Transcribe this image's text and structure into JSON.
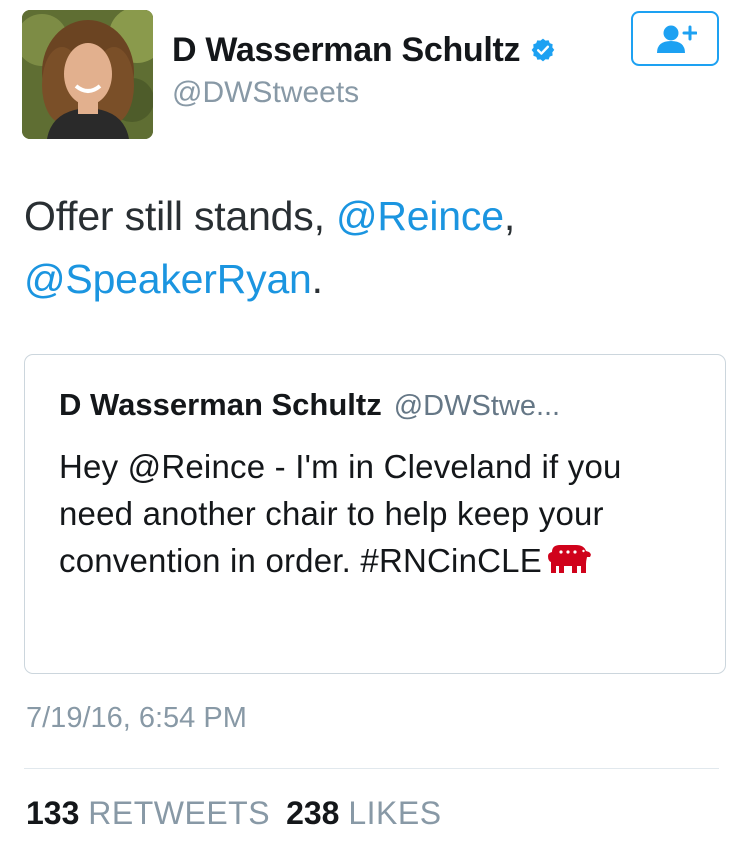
{
  "author": {
    "name": "D Wasserman Schultz",
    "handle": "@DWStweets",
    "verified": true
  },
  "follow_button": {
    "icon": "add-user-icon"
  },
  "tweet": {
    "text_prefix": "Offer still stands, ",
    "mention1": "@Reince",
    "text_mid": ",",
    "mention2": "@SpeakerRyan",
    "text_suffix": "."
  },
  "quoted_tweet": {
    "author_name": "D Wasserman Schultz",
    "author_handle": "@DWStwe...",
    "text": "Hey @Reince - I'm in Cleveland if you need another chair to help keep your convention in order. #RNCinCLE",
    "emoji": "elephant-icon"
  },
  "timestamp": "7/19/16, 6:54 PM",
  "stats": {
    "retweets_count": "133",
    "retweets_label": "RETWEETS",
    "likes_count": "238",
    "likes_label": "LIKES"
  },
  "colors": {
    "link": "#1b95e0",
    "verified": "#1da1f2",
    "muted": "#8899a6",
    "elephant": "#d0021b"
  }
}
